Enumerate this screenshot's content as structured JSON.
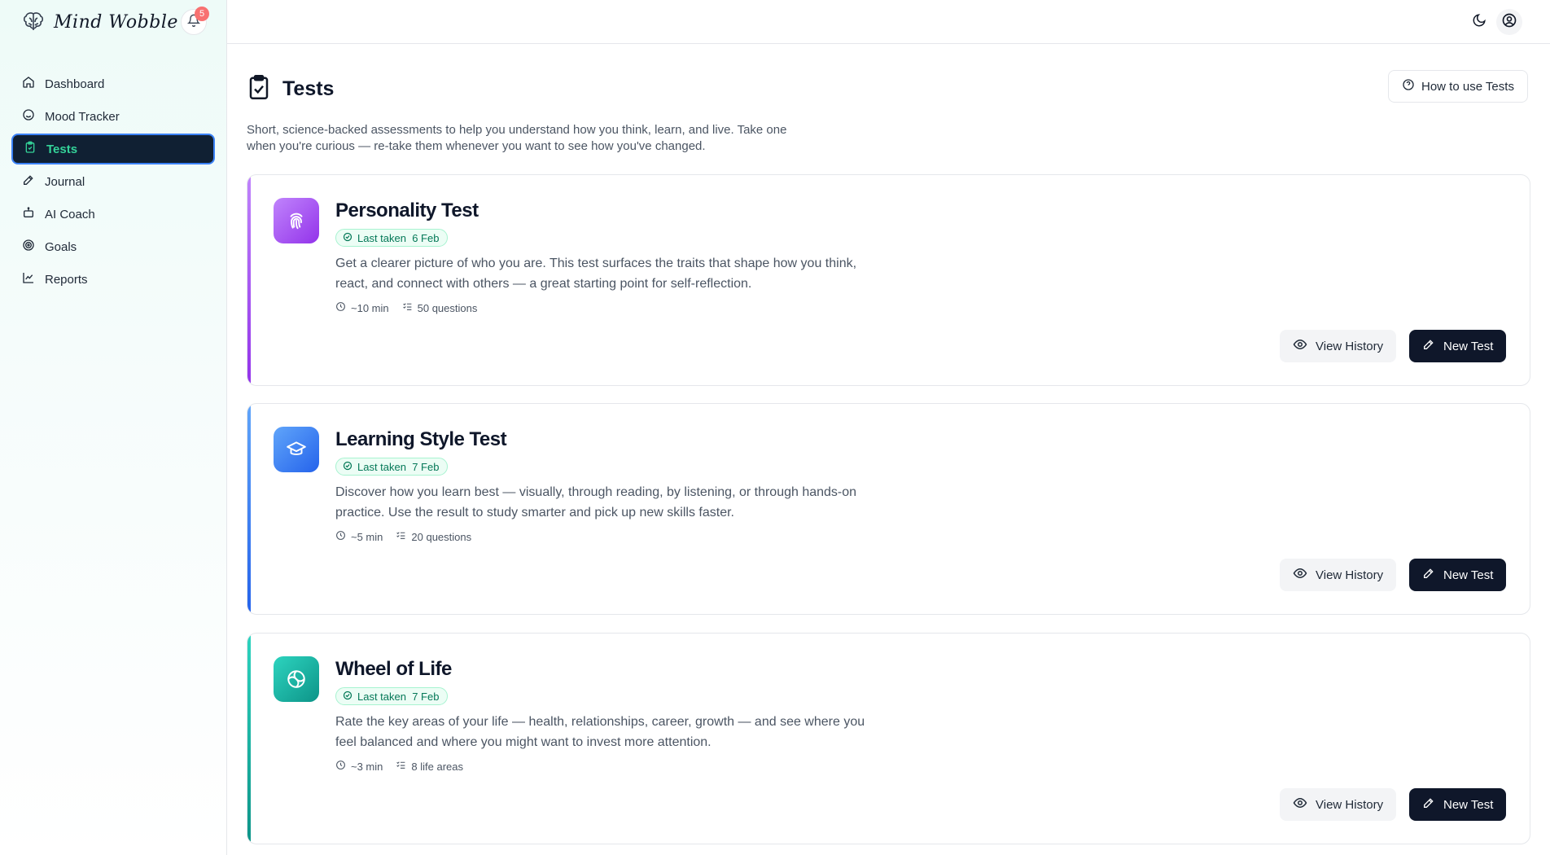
{
  "app": {
    "name": "Mind Wobble",
    "notifications_count": "5"
  },
  "sidebar": {
    "items": [
      {
        "label": "Dashboard",
        "icon": "home-icon"
      },
      {
        "label": "Mood Tracker",
        "icon": "smile-icon"
      },
      {
        "label": "Tests",
        "icon": "clipboard-check-icon",
        "active": true
      },
      {
        "label": "Journal",
        "icon": "pencil-icon"
      },
      {
        "label": "AI Coach",
        "icon": "robot-icon"
      },
      {
        "label": "Goals",
        "icon": "target-icon"
      },
      {
        "label": "Reports",
        "icon": "chart-icon"
      }
    ]
  },
  "header": {
    "title": "Tests",
    "help_button": "How to use Tests"
  },
  "intro": "Short, science-backed assessments to help you understand how you think, learn, and live. Take one when you're curious — re-take them whenever you want to see how you've changed.",
  "tests": [
    {
      "title": "Personality Test",
      "last_taken": "Last taken  6 Feb",
      "description": "Get a clearer picture of who you are. This test surfaces the traits that shape how you think, react, and connect with others — a great starting point for self-reflection.",
      "duration": "~10 min",
      "count": "50 questions",
      "icon": "fingerprint-icon",
      "accent": "#a855f7",
      "view_label": "View History",
      "new_label": "New Test"
    },
    {
      "title": "Learning Style Test",
      "last_taken": "Last taken  7 Feb",
      "description": "Discover how you learn best — visually, through reading, by listening, or through hands-on practice. Use the result to study smarter and pick up new skills faster.",
      "duration": "~5 min",
      "count": "20 questions",
      "icon": "graduation-cap-icon",
      "accent": "#3b82f6",
      "view_label": "View History",
      "new_label": "New Test"
    },
    {
      "title": "Wheel of Life",
      "last_taken": "Last taken  7 Feb",
      "description": "Rate the key areas of your life — health, relationships, career, growth — and see where you feel balanced and where you might want to invest more attention.",
      "duration": "~3 min",
      "count": "8 life areas",
      "icon": "wheel-icon",
      "accent": "#14b8a6",
      "view_label": "View History",
      "new_label": "New Test"
    }
  ]
}
